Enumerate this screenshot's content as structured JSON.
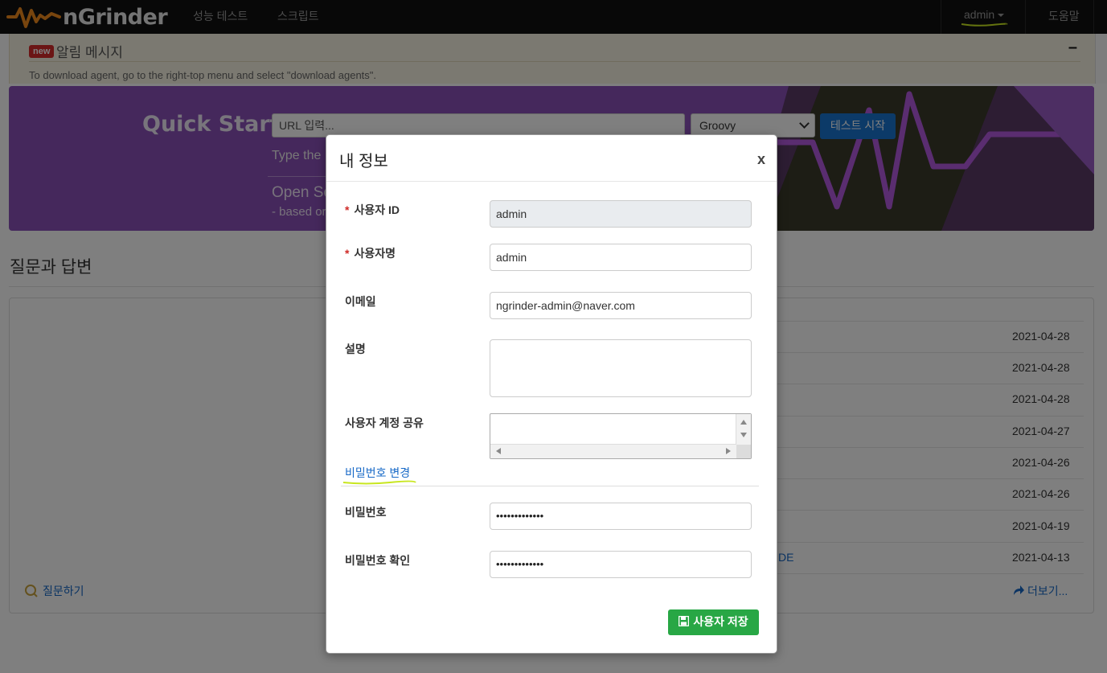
{
  "header": {
    "brand": "nGrinder",
    "nav": [
      "성능 테스트",
      "스크립트"
    ],
    "user": "admin",
    "help": "도움말"
  },
  "notice": {
    "badge": "new",
    "title": "알림 메시지",
    "text": "To download agent, go to the right-top menu and select \"download agents\".",
    "minimize": "–"
  },
  "quick_start": {
    "title": "Quick Start",
    "url_placeholder": "URL 입력...",
    "script_type": "Groovy",
    "start_button": "테스트 시작",
    "hint": "Type the",
    "open": "Open So",
    "based": "- based or"
  },
  "qa": {
    "title": "질문과 답변",
    "dates": [
      "2021-04-28",
      "2021-04-28",
      "2021-04-28",
      "2021-04-27",
      "2021-04-26",
      "2021-04-26",
      "2021-04-19",
      "2021-04-13"
    ],
    "visible_link_fragment": "DE",
    "ask": "질문하기",
    "more": "더보기..."
  },
  "modal": {
    "title": "내 정보",
    "close": "x",
    "required_mark": "*",
    "fields": {
      "user_id_label": "사용자 ID",
      "user_id_value": "admin",
      "user_name_label": "사용자명",
      "user_name_value": "admin",
      "email_label": "이메일",
      "email_value": "ngrinder-admin@naver.com",
      "description_label": "설명",
      "share_label": "사용자 계정 공유",
      "password_change_link": "비밀번호 변경",
      "password_label": "비밀번호",
      "password_value": "•••••••••••••",
      "password_confirm_label": "비밀번호 확인",
      "password_confirm_value": "•••••••••••••"
    },
    "save_button": "사용자 저장"
  }
}
